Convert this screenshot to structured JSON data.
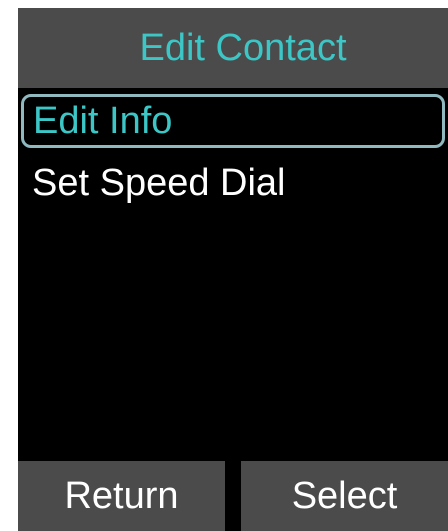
{
  "header": {
    "title": "Edit Contact"
  },
  "menu": {
    "items": [
      {
        "label": "Edit Info",
        "selected": true
      },
      {
        "label": "Set Speed Dial",
        "selected": false
      }
    ]
  },
  "softkeys": {
    "left": "Return",
    "right": "Select"
  },
  "colors": {
    "accent": "#3cc6c6",
    "bar": "#4b4b4b",
    "background": "#000000",
    "text": "#ffffff",
    "highlight_border": "#8fb8bf"
  }
}
